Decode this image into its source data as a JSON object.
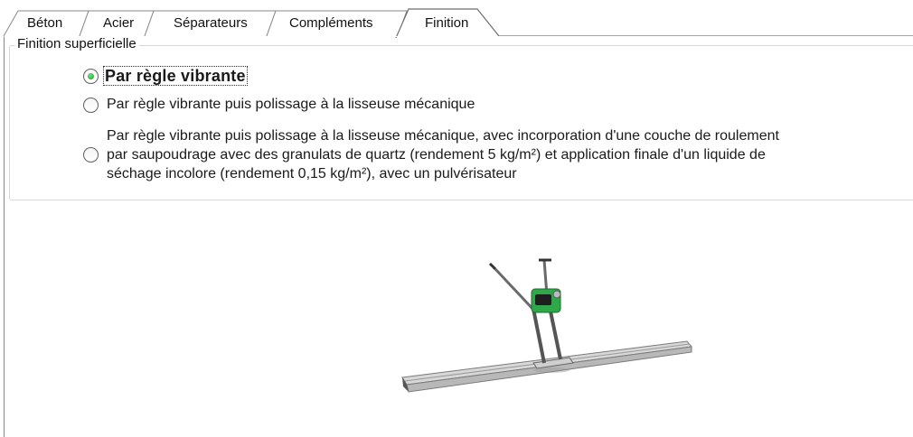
{
  "tabs": [
    {
      "label": "Béton"
    },
    {
      "label": "Acier"
    },
    {
      "label": "Séparateurs"
    },
    {
      "label": "Compléments"
    },
    {
      "label": "Finition",
      "active": true
    }
  ],
  "group": {
    "legend": "Finition superficielle",
    "selected_index": 0,
    "options": [
      {
        "label": "Par règle vibrante"
      },
      {
        "label": "Par règle vibrante puis polissage à la lisseuse mécanique"
      },
      {
        "lines": [
          "Par règle vibrante puis polissage à la lisseuse mécanique, avec incorporation d'une couche de roulement",
          "par saupoudrage avec des granulats de quartz (rendement 5 kg/m²) et application finale d'un liquide de",
          "séchage incolore (rendement 0,15 kg/m²), avec un pulvérisateur"
        ]
      }
    ]
  },
  "illustration": {
    "icon": "vibrating-screed-image"
  },
  "colors": {
    "radio_dot": "#1f9a2f",
    "machine_engine": "#2fa84a",
    "border": "#8a8a8a"
  }
}
